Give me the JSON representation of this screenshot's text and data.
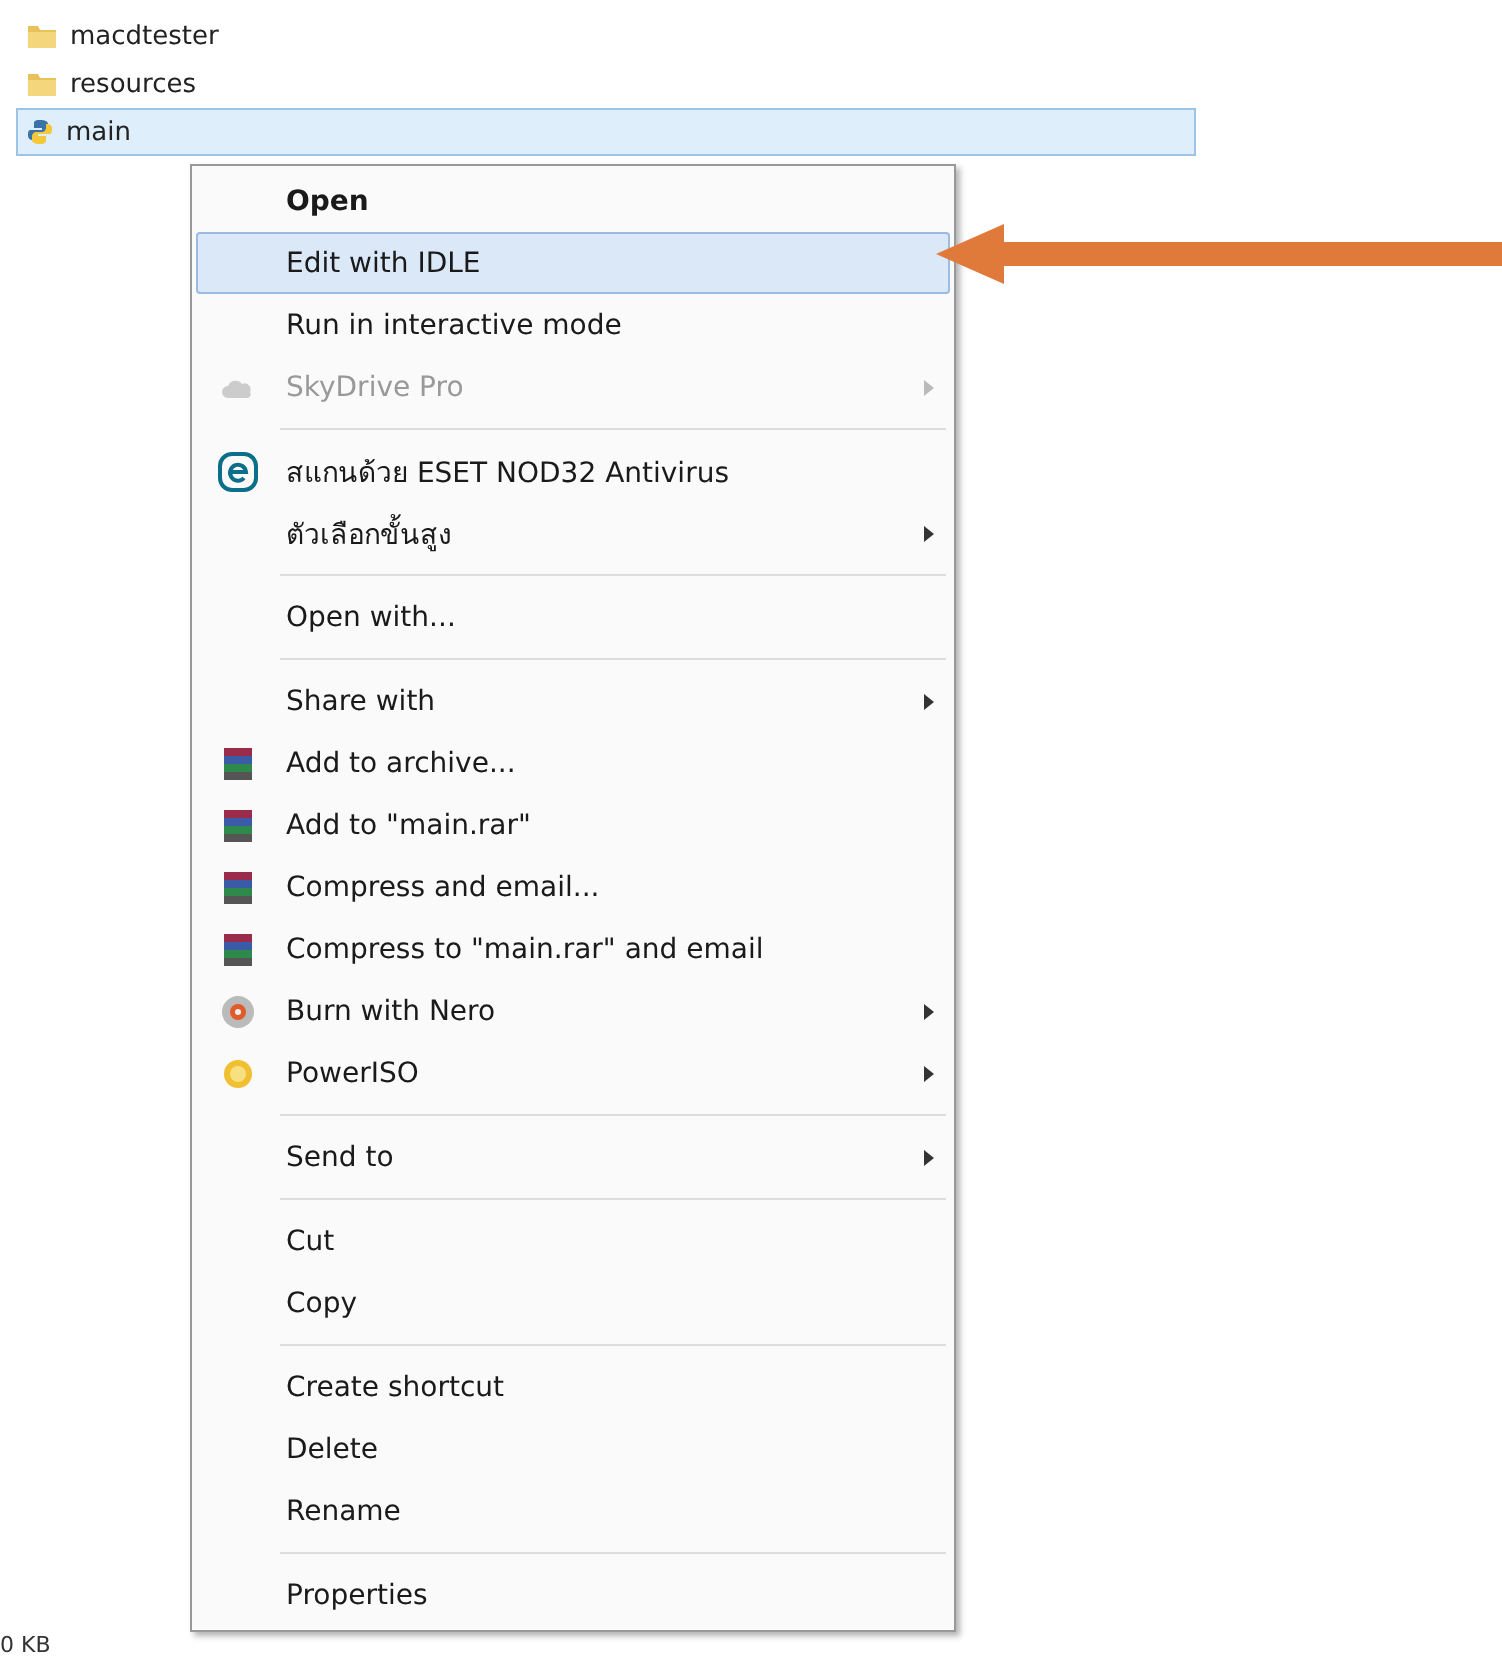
{
  "files": [
    {
      "name": "macdtester",
      "kind": "folder",
      "selected": false
    },
    {
      "name": "resources",
      "kind": "folder",
      "selected": false
    },
    {
      "name": "main",
      "kind": "python",
      "selected": true
    }
  ],
  "context_menu": [
    {
      "kind": "text",
      "label": "Open",
      "default": true,
      "selected": false,
      "disabled": false,
      "submenu": false
    },
    {
      "kind": "text",
      "label": "Edit with IDLE",
      "default": false,
      "selected": true,
      "disabled": false,
      "submenu": false
    },
    {
      "kind": "text",
      "label": "Run in interactive mode",
      "default": false,
      "selected": false,
      "disabled": false,
      "submenu": false
    },
    {
      "kind": "cloud",
      "label": "SkyDrive Pro",
      "default": false,
      "selected": false,
      "disabled": true,
      "submenu": true
    },
    {
      "kind": "separator"
    },
    {
      "kind": "eset",
      "label": "สแกนด้วย ESET NOD32 Antivirus",
      "default": false,
      "selected": false,
      "disabled": false,
      "submenu": false
    },
    {
      "kind": "text",
      "label": "ตัวเลือกขั้นสูง",
      "default": false,
      "selected": false,
      "disabled": false,
      "submenu": true
    },
    {
      "kind": "separator"
    },
    {
      "kind": "text",
      "label": "Open with...",
      "default": false,
      "selected": false,
      "disabled": false,
      "submenu": false
    },
    {
      "kind": "separator"
    },
    {
      "kind": "text",
      "label": "Share with",
      "default": false,
      "selected": false,
      "disabled": false,
      "submenu": true
    },
    {
      "kind": "archive",
      "label": "Add to archive...",
      "default": false,
      "selected": false,
      "disabled": false,
      "submenu": false
    },
    {
      "kind": "archive",
      "label": "Add to \"main.rar\"",
      "default": false,
      "selected": false,
      "disabled": false,
      "submenu": false
    },
    {
      "kind": "archive",
      "label": "Compress and email...",
      "default": false,
      "selected": false,
      "disabled": false,
      "submenu": false
    },
    {
      "kind": "archive",
      "label": "Compress to \"main.rar\" and email",
      "default": false,
      "selected": false,
      "disabled": false,
      "submenu": false
    },
    {
      "kind": "disc",
      "label": "Burn with Nero",
      "default": false,
      "selected": false,
      "disabled": false,
      "submenu": true
    },
    {
      "kind": "coin",
      "label": "PowerISO",
      "default": false,
      "selected": false,
      "disabled": false,
      "submenu": true
    },
    {
      "kind": "separator"
    },
    {
      "kind": "text",
      "label": "Send to",
      "default": false,
      "selected": false,
      "disabled": false,
      "submenu": true
    },
    {
      "kind": "separator"
    },
    {
      "kind": "text",
      "label": "Cut",
      "default": false,
      "selected": false,
      "disabled": false,
      "submenu": false
    },
    {
      "kind": "text",
      "label": "Copy",
      "default": false,
      "selected": false,
      "disabled": false,
      "submenu": false
    },
    {
      "kind": "separator"
    },
    {
      "kind": "text",
      "label": "Create shortcut",
      "default": false,
      "selected": false,
      "disabled": false,
      "submenu": false
    },
    {
      "kind": "text",
      "label": "Delete",
      "default": false,
      "selected": false,
      "disabled": false,
      "submenu": false
    },
    {
      "kind": "text",
      "label": "Rename",
      "default": false,
      "selected": false,
      "disabled": false,
      "submenu": false
    },
    {
      "kind": "separator"
    },
    {
      "kind": "text",
      "label": "Properties",
      "default": false,
      "selected": false,
      "disabled": false,
      "submenu": false
    }
  ],
  "status_bar": {
    "size": "0 KB"
  }
}
